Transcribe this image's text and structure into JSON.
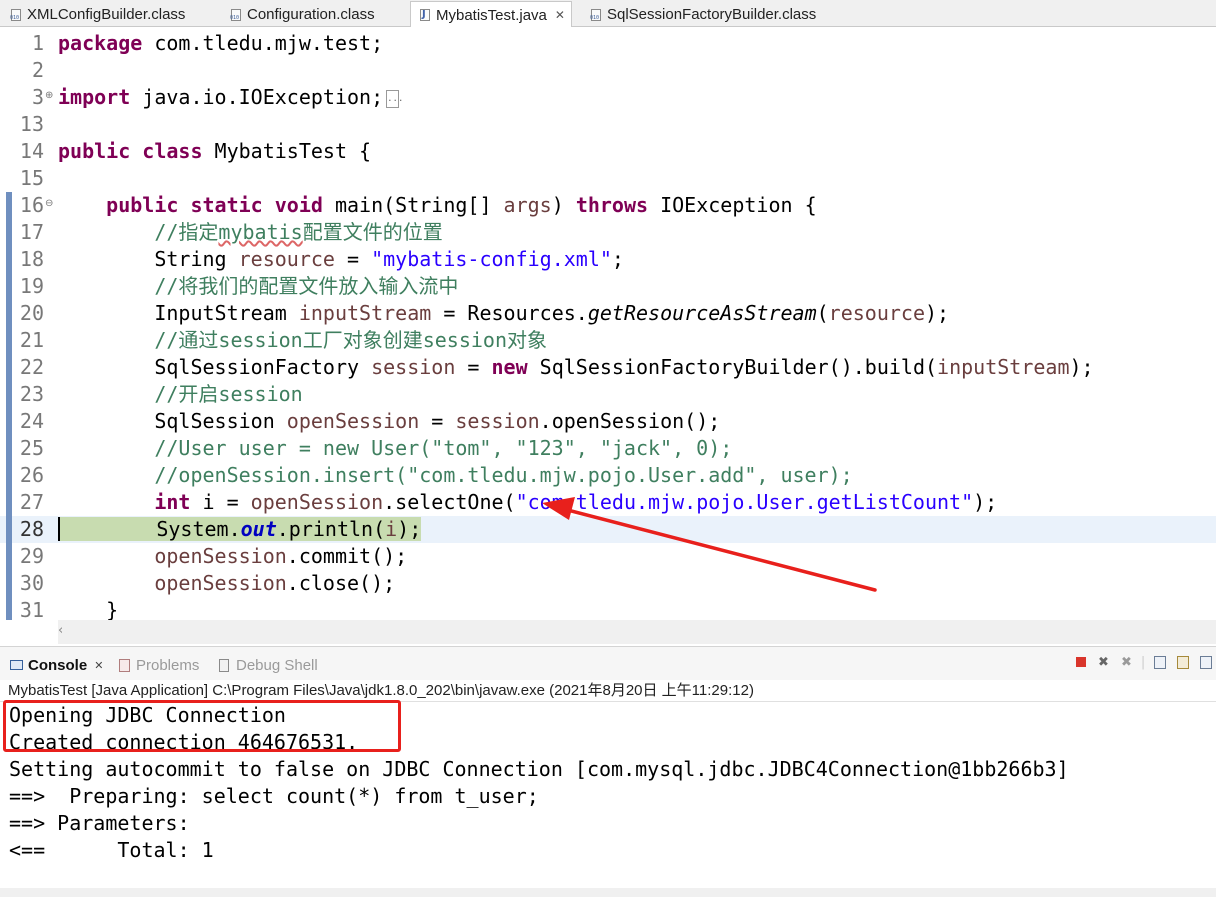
{
  "tabs": [
    {
      "label": "XMLConfigBuilder.class",
      "icon": "class-file-icon"
    },
    {
      "label": "Configuration.class",
      "icon": "class-file-icon"
    },
    {
      "label": "MybatisTest.java",
      "icon": "java-file-icon",
      "active": true,
      "close": "✕"
    },
    {
      "label": "SqlSessionFactoryBuilder.class",
      "icon": "class-file-icon"
    }
  ],
  "editor": {
    "line_numbers": [
      "1",
      "2",
      "3",
      "13",
      "14",
      "15",
      "16",
      "17",
      "18",
      "19",
      "20",
      "21",
      "22",
      "23",
      "24",
      "25",
      "26",
      "27",
      "28",
      "29",
      "30",
      "31"
    ],
    "collapsed_marker": "..."
  },
  "console": {
    "tabs": [
      {
        "label": "Console",
        "close": "✕",
        "active": true
      },
      {
        "label": "Problems"
      },
      {
        "label": "Debug Shell"
      }
    ],
    "process_line": "MybatisTest [Java Application] C:\\Program Files\\Java\\jdk1.8.0_202\\bin\\javaw.exe (2021年8月20日 上午11:29:12)",
    "output": [
      "Opening JDBC Connection",
      "Created connection 464676531.",
      "Setting autocommit to false on JDBC Connection [com.mysql.jdbc.JDBC4Connection@1bb266b3]",
      "==>  Preparing: select count(*) from t_user;",
      "==> Parameters: ",
      "<==      Total: 1"
    ]
  },
  "colors": {
    "keyword": "#7f0055",
    "string": "#2a00ff",
    "comment": "#3f7f5f",
    "annotation_red": "#e8201c"
  }
}
